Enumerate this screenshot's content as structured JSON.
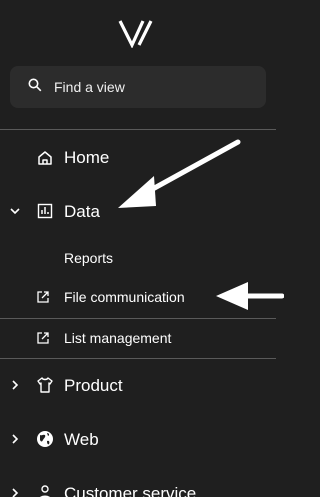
{
  "search": {
    "placeholder": "Find a view"
  },
  "nav": {
    "home": {
      "label": "Home",
      "icon": "home-icon"
    },
    "data": {
      "label": "Data",
      "icon": "chart-icon",
      "expanded": true
    },
    "product": {
      "label": "Product",
      "icon": "shirt-icon"
    },
    "web": {
      "label": "Web",
      "icon": "globe-icon"
    },
    "customer_service": {
      "label": "Customer service",
      "icon": "person-icon"
    }
  },
  "data_sub": {
    "reports": {
      "label": "Reports"
    },
    "file_communication": {
      "label": "File communication",
      "icon": "external-link-icon"
    },
    "list_management": {
      "label": "List management",
      "icon": "external-link-icon"
    }
  },
  "colors": {
    "background": "#1f1f1f",
    "search_bg": "#2c2c2c",
    "divider": "#5a5a5a",
    "text": "#ffffff"
  }
}
